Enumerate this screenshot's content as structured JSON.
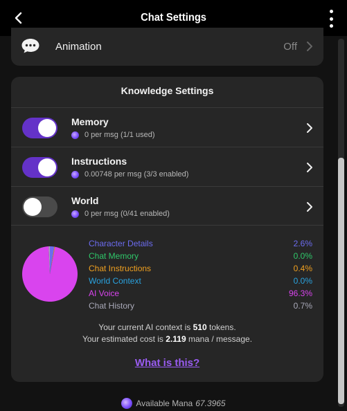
{
  "header": {
    "title": "Chat Settings",
    "back_icon": "chevron-left-icon",
    "menu_icon": "vertical-dots-icon"
  },
  "animation_row": {
    "icon": "chat-bubble-icon",
    "label": "Animation",
    "value": "Off"
  },
  "knowledge": {
    "heading": "Knowledge Settings",
    "rows": [
      {
        "name": "Memory",
        "enabled": true,
        "subtitle": "0 per msg (1/1 used)"
      },
      {
        "name": "Instructions",
        "enabled": true,
        "subtitle": "0.00748 per msg (3/3 enabled)"
      },
      {
        "name": "World",
        "enabled": false,
        "subtitle": "0 per msg (0/41 enabled)"
      }
    ],
    "legend": [
      {
        "name": "Character Details",
        "value": "2.6%",
        "color": "#6c6cf0"
      },
      {
        "name": "Chat Memory",
        "value": "0.0%",
        "color": "#2fc76a"
      },
      {
        "name": "Chat Instructions",
        "value": "0.4%",
        "color": "#f0a020"
      },
      {
        "name": "World Context",
        "value": "0.0%",
        "color": "#2aa3e0"
      },
      {
        "name": "AI Voice",
        "value": "96.3%",
        "color": "#d944ee"
      },
      {
        "name": "Chat History",
        "value": "0.7%",
        "color": "#a9a9b8"
      }
    ],
    "context": {
      "line1_prefix": "Your current AI context is",
      "tokens": "510",
      "line1_suffix": "tokens.",
      "line2_prefix": "Your estimated cost is",
      "cost": "2.119",
      "line2_suffix": "mana / message."
    },
    "help_link": "What is this?"
  },
  "footer": {
    "label": "Available Mana",
    "amount": "67.3965"
  },
  "colors": {
    "toggle_on": "#6432c8",
    "link": "#9a5cf2",
    "card": "#262626"
  },
  "chart_data": {
    "type": "pie",
    "categories": [
      "Character Details",
      "Chat Memory",
      "Chat Instructions",
      "World Context",
      "AI Voice",
      "Chat History"
    ],
    "values": [
      2.6,
      0.0,
      0.4,
      0.0,
      96.3,
      0.7
    ]
  }
}
